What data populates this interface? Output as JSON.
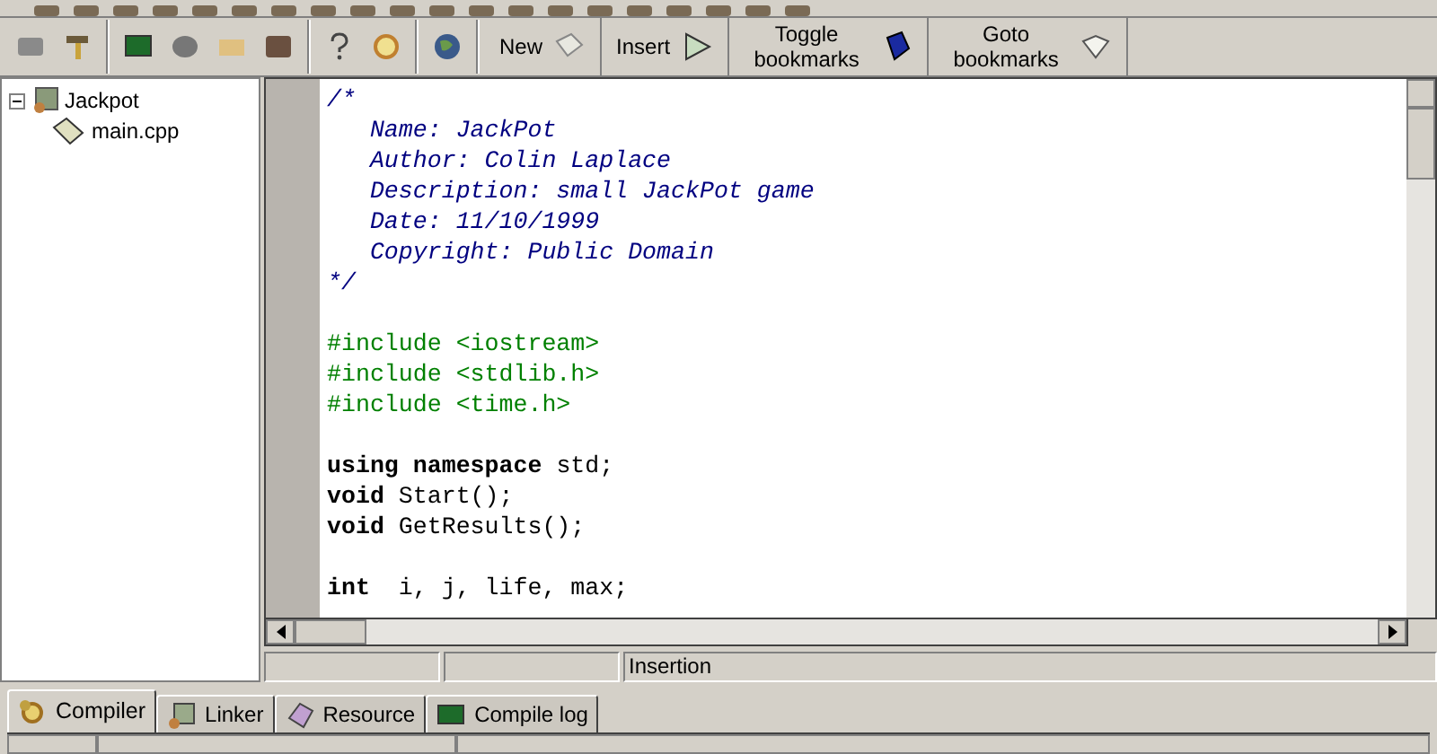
{
  "toolbar_buttons": [
    {
      "label": "New"
    },
    {
      "label": "Insert"
    },
    {
      "label": "Toggle bookmarks"
    },
    {
      "label": "Goto bookmarks"
    }
  ],
  "project_tree": [
    {
      "label": "Jackpot",
      "expanded": true,
      "children": [
        {
          "label": "main.cpp"
        }
      ]
    }
  ],
  "code_lines": [
    {
      "kind": "comment",
      "text": "/*"
    },
    {
      "kind": "comment",
      "text": "   Name: JackPot"
    },
    {
      "kind": "comment",
      "text": "   Author: Colin Laplace"
    },
    {
      "kind": "comment",
      "text": "   Description: small JackPot game"
    },
    {
      "kind": "comment",
      "text": "   Date: 11/10/1999"
    },
    {
      "kind": "comment",
      "text": "   Copyright: Public Domain"
    },
    {
      "kind": "comment",
      "text": "*/"
    },
    {
      "kind": "blank"
    },
    {
      "kind": "preprocessor",
      "text": "#include <iostream>"
    },
    {
      "kind": "preprocessor",
      "text": "#include <stdlib.h>"
    },
    {
      "kind": "preprocessor",
      "text": "#include <time.h>"
    },
    {
      "kind": "blank"
    },
    {
      "kind": "code",
      "text": "**using** **namespace** std;"
    },
    {
      "kind": "code",
      "text": "**void** Start();"
    },
    {
      "kind": "code",
      "text": "**void** GetResults();"
    },
    {
      "kind": "blank"
    },
    {
      "kind": "code",
      "text": "**int**  i, j, life, max;"
    }
  ],
  "status_bar": {
    "mode": "Insertion"
  },
  "bottom_tabs": [
    {
      "label": "Compiler",
      "selected": true
    },
    {
      "label": "Linker",
      "selected": false
    },
    {
      "label": "Resource",
      "selected": false
    },
    {
      "label": "Compile log",
      "selected": false
    }
  ]
}
